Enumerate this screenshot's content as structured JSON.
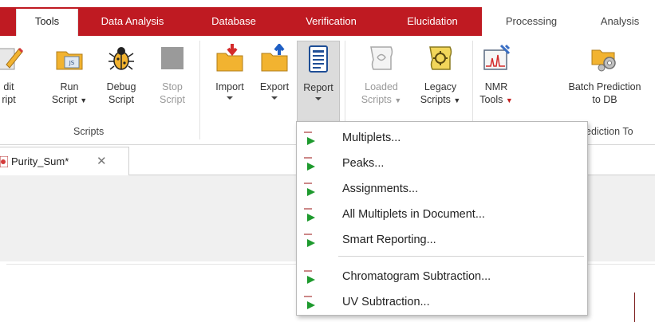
{
  "tabs": [
    {
      "label": "Tools",
      "active": true
    },
    {
      "label": "Data Analysis"
    },
    {
      "label": "Database"
    },
    {
      "label": "Verification"
    },
    {
      "label": "Elucidation"
    },
    {
      "label": "Processing"
    },
    {
      "label": "Analysis"
    }
  ],
  "ribbon": {
    "edit": {
      "line1": "dit",
      "line2": "ript"
    },
    "run": {
      "line1": "Run",
      "line2": "Script"
    },
    "debug": {
      "line1": "Debug",
      "line2": "Script"
    },
    "stop": {
      "line1": "Stop",
      "line2": "Script"
    },
    "scripts_group": "Scripts",
    "import": {
      "line1": "Import"
    },
    "export": {
      "line1": "Export"
    },
    "report": {
      "line1": "Report"
    },
    "loaded": {
      "line1": "Loaded",
      "line2": "Scripts"
    },
    "legacy": {
      "line1": "Legacy",
      "line2": "Scripts"
    },
    "nmr": {
      "line1": "NMR",
      "line2": "Tools"
    },
    "batch": {
      "line1": "Batch Prediction",
      "line2": "to DB"
    },
    "prediction_group": "ediction To"
  },
  "document_tab": {
    "label": "Purity_Sum*",
    "close": "✕"
  },
  "menu": {
    "items": [
      {
        "label": "Multiplets..."
      },
      {
        "label": "Peaks..."
      },
      {
        "label": "Assignments..."
      },
      {
        "label": "All Multiplets in Document..."
      },
      {
        "label": "Smart Reporting..."
      },
      {
        "label": "Chromatogram Subtraction..."
      },
      {
        "label": "UV Subtraction..."
      }
    ]
  },
  "colors": {
    "accent_red": "#bf1a22",
    "icon_green": "#1e9a2e",
    "folder_yellow": "#f2b330"
  },
  "icons": {
    "edit": "edit-script-icon",
    "run": "run-script-icon",
    "debug": "debug-bug-icon",
    "stop": "stop-square-icon",
    "import": "import-folder-icon",
    "export": "export-folder-icon",
    "report": "report-document-icon",
    "loaded": "loaded-scripts-icon",
    "legacy": "legacy-scripts-icon",
    "nmr": "nmr-tools-icon",
    "batch": "batch-prediction-icon",
    "menu_item": "report-item-icon"
  }
}
